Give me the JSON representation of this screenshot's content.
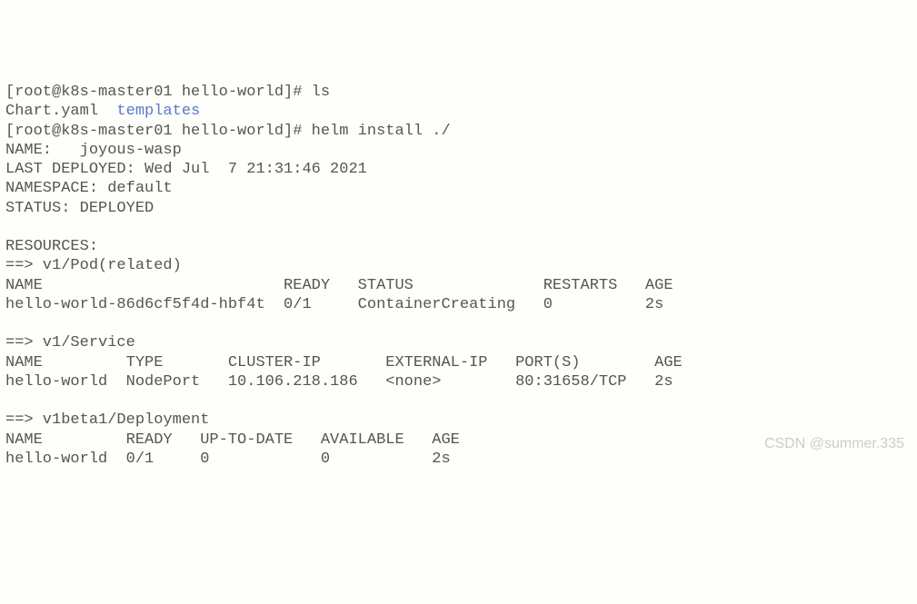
{
  "lines": {
    "prompt1": "[root@k8s-master01 hello-world]# ls",
    "ls_file": "Chart.yaml  ",
    "ls_dir": "templates",
    "prompt2": "[root@k8s-master01 hello-world]# helm install ./",
    "name": "NAME:   joyous-wasp",
    "last_deployed": "LAST DEPLOYED: Wed Jul  7 21:31:46 2021",
    "namespace": "NAMESPACE: default",
    "status": "STATUS: DEPLOYED",
    "blank1": "",
    "resources": "RESOURCES:",
    "pod_header": "==> v1/Pod(related)",
    "pod_cols": "NAME                          READY   STATUS              RESTARTS   AGE",
    "pod_row": "hello-world-86d6cf5f4d-hbf4t  0/1     ContainerCreating   0          2s",
    "blank2": "",
    "svc_header": "==> v1/Service",
    "svc_cols": "NAME         TYPE       CLUSTER-IP       EXTERNAL-IP   PORT(S)        AGE",
    "svc_row": "hello-world  NodePort   10.106.218.186   <none>        80:31658/TCP   2s",
    "blank3": "",
    "dep_header": "==> v1beta1/Deployment",
    "dep_cols": "NAME         READY   UP-TO-DATE   AVAILABLE   AGE",
    "dep_row": "hello-world  0/1     0            0           2s"
  },
  "watermark": "CSDN @summer.335"
}
